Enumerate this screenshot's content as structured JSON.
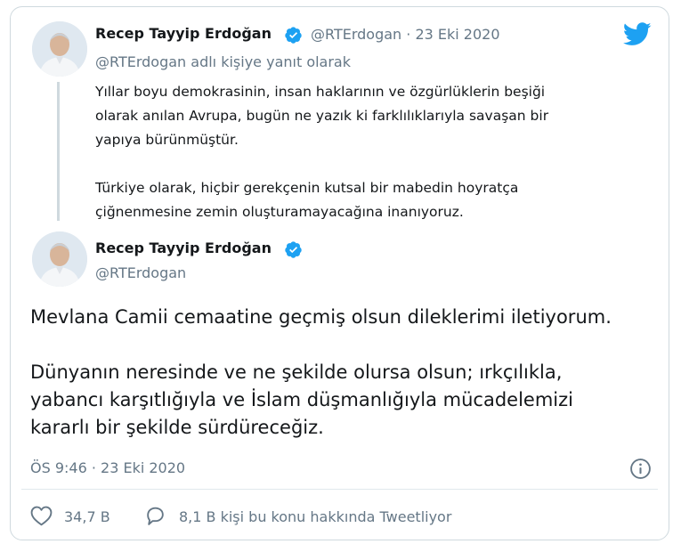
{
  "reply_tweet": {
    "author_name": "Recep Tayyip Erdoğan",
    "handle_date": "@RTErdogan · 23 Eki 2020",
    "reply_to": "@RTErdogan adlı kişiye yanıt olarak",
    "text": "Yıllar boyu demokrasinin, insan haklarının ve özgürlüklerin beşiği\nolarak anılan Avrupa, bugün ne yazık ki farklılıklarıyla savaşan bir\nyapıya bürünmüştür.\n\nTürkiye olarak, hiçbir gerekçenin kutsal bir mabedin hoyratça\nçiğnenmesine zemin oluşturamayacağına inanıyoruz."
  },
  "main_tweet": {
    "author_name": "Recep Tayyip Erdoğan",
    "handle": "@RTErdogan",
    "text": "Mevlana Camii cemaatine geçmiş olsun dileklerimi iletiyorum.\n\nDünyanın neresinde ve ne şekilde olursa olsun; ırkçılıkla,\nyabancı karşıtlığıyla ve İslam düşmanlığıyla mücadelemizi\nkararlı bir şekilde sürdüreceğiz.",
    "timestamp": "ÖS 9:46 · 23 Eki 2020"
  },
  "stats": {
    "likes": "34,7 B",
    "retweet_talk": "8,1 B kişi bu konu hakkında Tweetliyor"
  },
  "colors": {
    "twitter_blue": "#1da1f2",
    "secondary_text": "#657786",
    "border": "#cfd9de"
  },
  "icons": [
    "twitter-logo-icon",
    "verified-badge-icon",
    "info-icon",
    "heart-icon",
    "comment-icon"
  ]
}
